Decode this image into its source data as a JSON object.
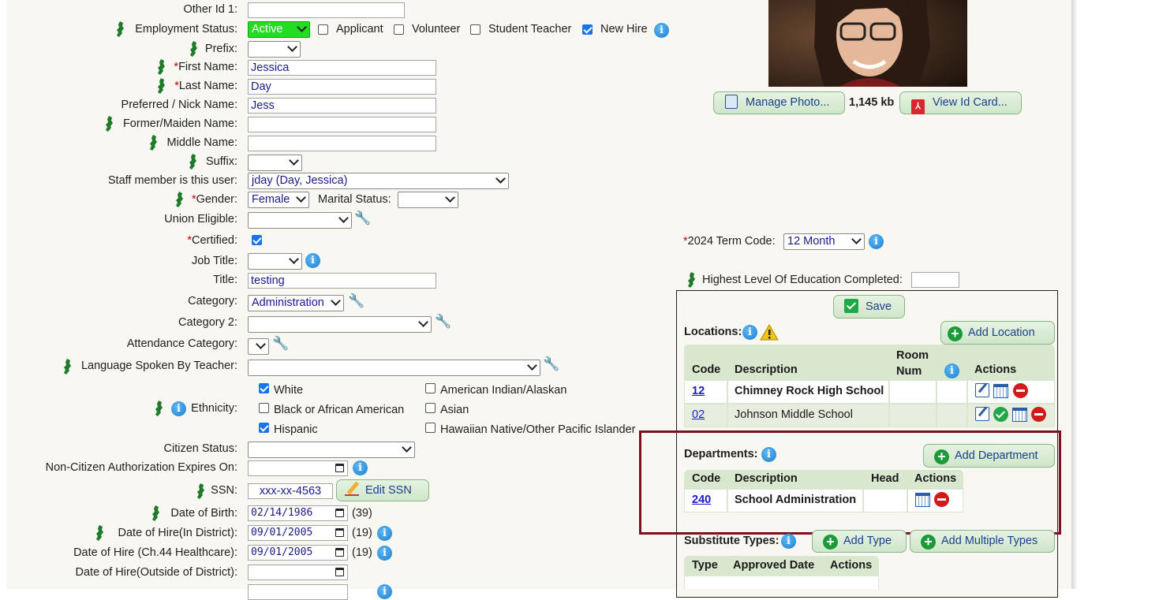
{
  "form": {
    "other_id1": {
      "label": "Other Id 1:",
      "value": ""
    },
    "employment_status": {
      "label": "Employment Status:",
      "value": "Active",
      "applicant": "Applicant",
      "volunteer": "Volunteer",
      "student_teacher": "Student Teacher",
      "new_hire": "New Hire",
      "new_hire_checked": true
    },
    "prefix": {
      "label": "Prefix:",
      "value": ""
    },
    "first_name": {
      "label": "First Name:",
      "value": "Jessica",
      "req": "*"
    },
    "last_name": {
      "label": "Last Name:",
      "value": "Day",
      "req": "*"
    },
    "nick_name": {
      "label": "Preferred / Nick Name:",
      "value": "Jess"
    },
    "maiden_name": {
      "label": "Former/Maiden Name:",
      "value": ""
    },
    "middle_name": {
      "label": "Middle Name:",
      "value": ""
    },
    "suffix": {
      "label": "Suffix:",
      "value": ""
    },
    "staff_user": {
      "label": "Staff member is this user:",
      "value": "jday (Day, Jessica)"
    },
    "gender": {
      "label": "Gender:",
      "value": "Female",
      "req": "*"
    },
    "marital_status": {
      "label": "Marital Status:",
      "value": ""
    },
    "union_eligible": {
      "label": "Union Eligible:",
      "value": ""
    },
    "certified": {
      "label": "Certified:",
      "req": "*",
      "checked": true
    },
    "job_title": {
      "label": "Job Title:",
      "value": ""
    },
    "title": {
      "label": "Title:",
      "value": "testing"
    },
    "category": {
      "label": "Category:",
      "value": "Administration"
    },
    "category2": {
      "label": "Category 2:",
      "value": ""
    },
    "attendance_category": {
      "label": "Attendance Category:",
      "value": ""
    },
    "language": {
      "label": "Language Spoken By Teacher:",
      "value": ""
    },
    "ethnicity": {
      "label": "Ethnicity:",
      "options": [
        {
          "label": "White",
          "checked": true
        },
        {
          "label": "Black or African American",
          "checked": false
        },
        {
          "label": "Hispanic",
          "checked": true
        },
        {
          "label": "American Indian/Alaskan",
          "checked": false
        },
        {
          "label": "Asian",
          "checked": false
        },
        {
          "label": "Hawaiian Native/Other Pacific Islander",
          "checked": false
        }
      ]
    },
    "citizen_status": {
      "label": "Citizen Status:",
      "value": ""
    },
    "non_citizen_expires": {
      "label": "Non-Citizen Authorization Expires On:",
      "value": ""
    },
    "ssn": {
      "label": "SSN:",
      "value": "xxx-xx-4563",
      "edit_button": "Edit SSN"
    },
    "dob": {
      "label": "Date of Birth:",
      "value": "02/14/1986",
      "age": "(39)"
    },
    "doh_in_district": {
      "label": "Date of Hire(In District):",
      "value": "09/01/2005",
      "years": "(19)"
    },
    "doh_ch44": {
      "label": "Date of Hire (Ch.44 Healthcare):",
      "value": "09/01/2005",
      "years": "(19)"
    },
    "doh_outside": {
      "label": "Date of Hire(Outside of District):",
      "value": ""
    }
  },
  "photo": {
    "manage_button": "Manage Photo...",
    "size": "1,145 kb",
    "id_card_button": "View Id Card..."
  },
  "term_code": {
    "label": "2024 Term Code:",
    "req": "*",
    "value": "12 Month"
  },
  "education": {
    "label": "Highest Level Of Education Completed:",
    "value": ""
  },
  "save_button": "Save",
  "locations": {
    "label": "Locations:",
    "add_button": "Add Location",
    "headers": {
      "code": "Code",
      "description": "Description",
      "room": "Room Num",
      "actions": "Actions"
    },
    "rows": [
      {
        "code": "12",
        "description": "Chimney Rock High School",
        "room": ""
      },
      {
        "code": "02",
        "description": "Johnson Middle School",
        "room": ""
      }
    ]
  },
  "departments": {
    "label": "Departments:",
    "add_button": "Add Department",
    "headers": {
      "code": "Code",
      "description": "Description",
      "head": "Head",
      "actions": "Actions"
    },
    "rows": [
      {
        "code": "240",
        "description": "School Administration",
        "head": ""
      }
    ]
  },
  "substitute_types": {
    "label": "Substitute Types:",
    "add_type": "Add Type",
    "add_multiple": "Add Multiple Types",
    "headers": {
      "type": "Type",
      "approved": "Approved Date",
      "actions": "Actions"
    }
  },
  "colors": {
    "page_bg": "#f8f7f2",
    "active_status": "#22dd22",
    "highlight_border": "#7a1020",
    "header_green": "#d8e7cd"
  }
}
